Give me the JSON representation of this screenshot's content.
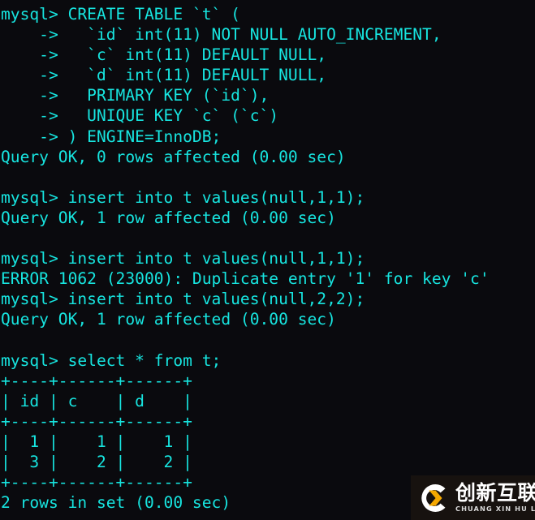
{
  "terminal": {
    "prompt": "mysql>",
    "continuation_prompt": "->",
    "text_color": "#17e5e0",
    "background_color": "#0a0a0e",
    "lines": [
      "mysql> CREATE TABLE `t` (",
      "    ->   `id` int(11) NOT NULL AUTO_INCREMENT,",
      "    ->   `c` int(11) DEFAULT NULL,",
      "    ->   `d` int(11) DEFAULT NULL,",
      "    ->   PRIMARY KEY (`id`),",
      "    ->   UNIQUE KEY `c` (`c`)",
      "    -> ) ENGINE=InnoDB;",
      "Query OK, 0 rows affected (0.00 sec)",
      "",
      "mysql> insert into t values(null,1,1);",
      "Query OK, 1 row affected (0.00 sec)",
      "",
      "mysql> insert into t values(null,1,1);",
      "ERROR 1062 (23000): Duplicate entry '1' for key 'c'",
      "mysql> insert into t values(null,2,2);",
      "Query OK, 1 row affected (0.00 sec)",
      "",
      "mysql> select * from t;",
      "+----+------+------+",
      "| id | c    | d    |",
      "+----+------+------+",
      "|  1 |    1 |    1 |",
      "|  3 |    2 |    2 |",
      "+----+------+------+",
      "2 rows in set (0.00 sec)"
    ],
    "result_table": {
      "columns": [
        "id",
        "c",
        "d"
      ],
      "rows": [
        [
          "1",
          "1",
          "1"
        ],
        [
          "3",
          "2",
          "2"
        ]
      ],
      "footer": "2 rows in set (0.00 sec)"
    },
    "statuses": [
      "Query OK, 0 rows affected (0.00 sec)",
      "Query OK, 1 row affected (0.00 sec)",
      "ERROR 1062 (23000): Duplicate entry '1' for key 'c'",
      "Query OK, 1 row affected (0.00 sec)",
      "2 rows in set (0.00 sec)"
    ]
  },
  "watermark": {
    "chinese_name": "创新互联",
    "pinyin": "CHUANG XIN HU LIAN",
    "mark_letter": "C",
    "accent_color": "#f5a800",
    "mark_color": "#ffffff",
    "panel_color": "#17120f"
  }
}
